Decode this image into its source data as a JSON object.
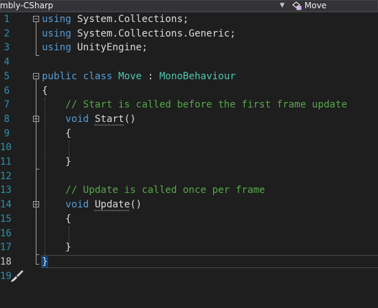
{
  "navbar": {
    "project_dropdown": "mbly-CSharp",
    "member_dropdown": "Move",
    "member_icon": "class-member-icon",
    "dropdown_arrow": "chevron-down-icon"
  },
  "editor": {
    "line_numbers": [
      "1",
      "2",
      "3",
      "4",
      "5",
      "6",
      "7",
      "8",
      "9",
      "10",
      "11",
      "12",
      "13",
      "14",
      "15",
      "16",
      "17",
      "18",
      "19"
    ],
    "current_line": "18",
    "lines": [
      {
        "tokens": [
          {
            "t": "using",
            "c": "kw"
          },
          {
            "t": " System.Collections;",
            "c": "pl"
          }
        ]
      },
      {
        "tokens": [
          {
            "t": "using",
            "c": "kw"
          },
          {
            "t": " System.Collections.Generic;",
            "c": "pl"
          }
        ]
      },
      {
        "tokens": [
          {
            "t": "using",
            "c": "kw"
          },
          {
            "t": " UnityEngine;",
            "c": "pl"
          }
        ]
      },
      {
        "tokens": []
      },
      {
        "tokens": [
          {
            "t": "public",
            "c": "kw"
          },
          {
            "t": " ",
            "c": "pl"
          },
          {
            "t": "class",
            "c": "kw"
          },
          {
            "t": " ",
            "c": "pl"
          },
          {
            "t": "Move",
            "c": "ty"
          },
          {
            "t": " : ",
            "c": "pl"
          },
          {
            "t": "MonoBehaviour",
            "c": "ty"
          }
        ]
      },
      {
        "tokens": [
          {
            "t": "{",
            "c": "pl"
          }
        ]
      },
      {
        "tokens": [
          {
            "t": "    ",
            "c": "pl"
          },
          {
            "t": "// Start is called before the first frame update",
            "c": "cm"
          }
        ]
      },
      {
        "tokens": [
          {
            "t": "    ",
            "c": "pl"
          },
          {
            "t": "void",
            "c": "kw"
          },
          {
            "t": " ",
            "c": "pl"
          },
          {
            "t": "Start",
            "c": "fn"
          },
          {
            "t": "()",
            "c": "pl"
          }
        ]
      },
      {
        "tokens": [
          {
            "t": "    {",
            "c": "pl"
          }
        ]
      },
      {
        "tokens": []
      },
      {
        "tokens": [
          {
            "t": "    }",
            "c": "pl"
          }
        ]
      },
      {
        "tokens": []
      },
      {
        "tokens": [
          {
            "t": "    ",
            "c": "pl"
          },
          {
            "t": "// Update is called once per frame",
            "c": "cm"
          }
        ]
      },
      {
        "tokens": [
          {
            "t": "    ",
            "c": "pl"
          },
          {
            "t": "void",
            "c": "kw"
          },
          {
            "t": " ",
            "c": "pl"
          },
          {
            "t": "Update",
            "c": "fn"
          },
          {
            "t": "()",
            "c": "pl"
          }
        ]
      },
      {
        "tokens": [
          {
            "t": "    {",
            "c": "pl"
          }
        ]
      },
      {
        "tokens": []
      },
      {
        "tokens": [
          {
            "t": "    }",
            "c": "pl"
          }
        ]
      },
      {
        "tokens": [
          {
            "t": "}",
            "c": "hl"
          }
        ]
      },
      {
        "tokens": []
      }
    ],
    "fold_lines": [
      "1",
      "5",
      "8",
      "14"
    ],
    "quick_action_icon": "paintbrush-icon",
    "colors": {
      "background": "#1e1e1e",
      "keyword": "#569cd6",
      "type": "#4ec9b0",
      "comment": "#57a64a",
      "plain": "#dcdcdc",
      "line_number": "#2b91af",
      "brace_highlight": "#0e4583"
    }
  }
}
